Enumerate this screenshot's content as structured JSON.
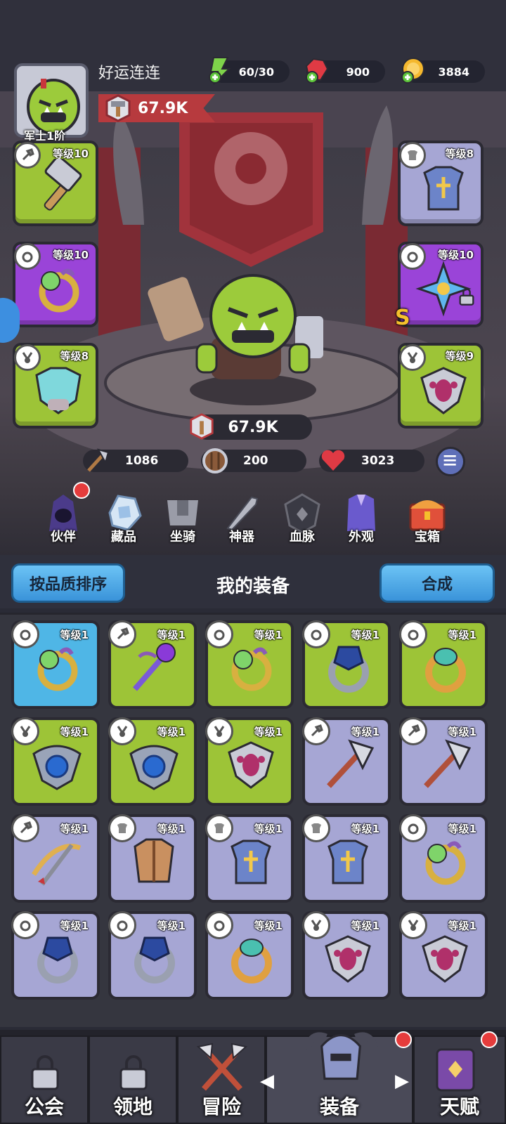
{
  "player": {
    "name": "好运连连",
    "rank": "军士1阶",
    "power": "67.9K"
  },
  "resources": [
    {
      "icon": "energy-icon",
      "value": "60/30"
    },
    {
      "icon": "ruby-icon",
      "value": "900"
    },
    {
      "icon": "gold-coin-icon",
      "value": "3884"
    }
  ],
  "equipped": {
    "weapon": {
      "level": "等级10",
      "icon": "hammer-icon"
    },
    "ring": {
      "level": "等级10",
      "icon": "ring-icon"
    },
    "helmet": {
      "level": "等级8",
      "icon": "helmet-icon"
    },
    "armor": {
      "level": "等级8",
      "icon": "armor-icon"
    },
    "artifact": {
      "level": "等级10",
      "icon": "shuriken-icon",
      "grade": "S"
    },
    "amulet": {
      "level": "等级9",
      "icon": "amulet-icon"
    }
  },
  "hero": {
    "power": "67.9K"
  },
  "stats": {
    "attack": "1086",
    "defense": "200",
    "hp": "3023"
  },
  "nav": [
    "伙伴",
    "藏品",
    "坐骑",
    "神器",
    "血脉",
    "外观",
    "宝箱"
  ],
  "panel": {
    "sort_label": "按品质排序",
    "title": "我的装备",
    "merge_label": "合成"
  },
  "inventory": [
    {
      "level": "等级1",
      "item": "ring",
      "color": "blue"
    },
    {
      "level": "等级1",
      "item": "staff",
      "color": "green"
    },
    {
      "level": "等级1",
      "item": "ring",
      "color": "green"
    },
    {
      "level": "等级1",
      "item": "dark-ring",
      "color": "green"
    },
    {
      "level": "等级1",
      "item": "gold-ring",
      "color": "green"
    },
    {
      "level": "等级1",
      "item": "amulet",
      "color": "green"
    },
    {
      "level": "等级1",
      "item": "amulet",
      "color": "green"
    },
    {
      "level": "等级1",
      "item": "gem-amulet",
      "color": "green"
    },
    {
      "level": "等级1",
      "item": "axe",
      "color": "lilac"
    },
    {
      "level": "等级1",
      "item": "axe",
      "color": "lilac"
    },
    {
      "level": "等级1",
      "item": "crossbow",
      "color": "lilac"
    },
    {
      "level": "等级1",
      "item": "vest",
      "color": "lilac"
    },
    {
      "level": "等级1",
      "item": "armor",
      "color": "lilac"
    },
    {
      "level": "等级1",
      "item": "armor",
      "color": "lilac"
    },
    {
      "level": "等级1",
      "item": "ring",
      "color": "lilac"
    },
    {
      "level": "等级1",
      "item": "dark-ring",
      "color": "lilac"
    },
    {
      "level": "等级1",
      "item": "dark-ring",
      "color": "lilac"
    },
    {
      "level": "等级1",
      "item": "gold-ring",
      "color": "lilac"
    },
    {
      "level": "等级1",
      "item": "gem-amulet",
      "color": "lilac"
    },
    {
      "level": "等级1",
      "item": "gem-amulet",
      "color": "lilac"
    }
  ],
  "bottom_tabs": [
    "公会",
    "领地",
    "冒险",
    "装备",
    "天赋"
  ],
  "colors": {
    "green": "#9dc437",
    "purple": "#9a44d8",
    "lilac": "#a6a6d4",
    "blue": "#4fb6e6",
    "accent_red": "#e53c3c"
  }
}
